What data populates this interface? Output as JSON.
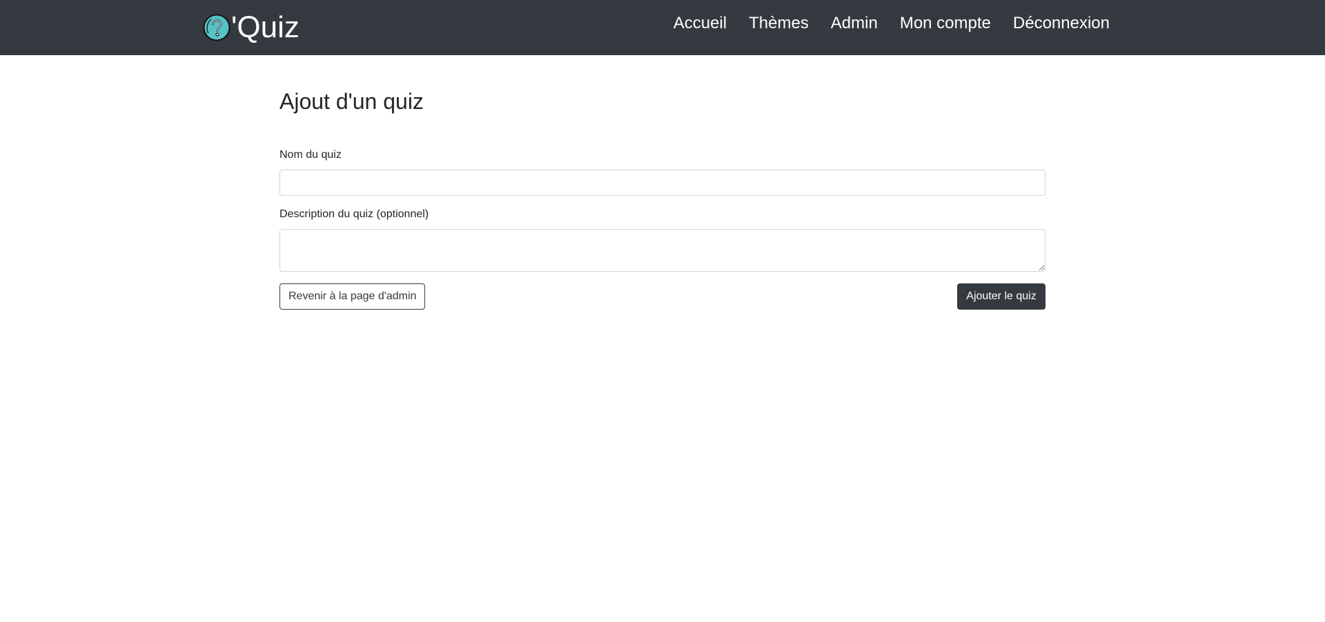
{
  "navbar": {
    "brand_text": "'Quiz",
    "logo_icon": "question-mark-circle-icon",
    "logo_color": "#56c2c6",
    "background_color": "#343a40",
    "links": [
      {
        "label": "Accueil"
      },
      {
        "label": "Thèmes"
      },
      {
        "label": "Admin"
      },
      {
        "label": "Mon compte"
      },
      {
        "label": "Déconnexion"
      }
    ]
  },
  "page": {
    "title": "Ajout d'un quiz"
  },
  "form": {
    "name_label": "Nom du quiz",
    "name_value": "",
    "description_label": "Description du quiz (optionnel)",
    "description_value": "",
    "back_button_label": "Revenir à la page d'admin",
    "submit_button_label": "Ajouter le quiz"
  }
}
